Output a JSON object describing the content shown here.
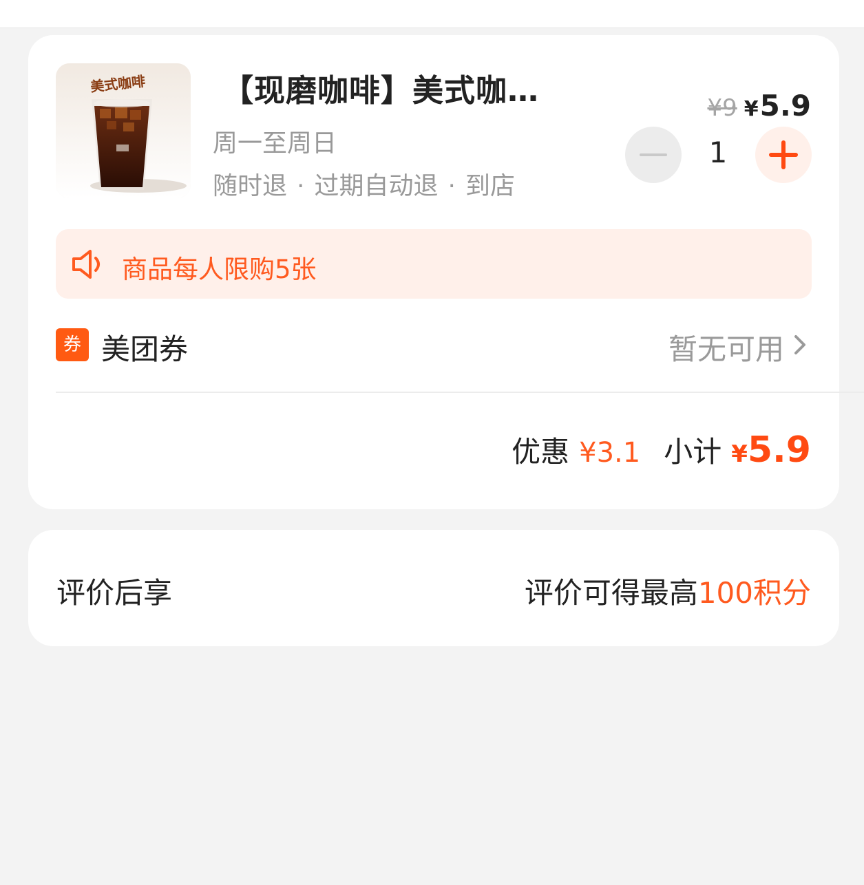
{
  "product": {
    "image_caption": "美式咖啡",
    "title": "【现磨咖啡】美式咖…",
    "validity": "周一至周日",
    "policy": [
      "随时退",
      "过期自动退",
      "到店"
    ],
    "policy_separator": "·",
    "original_price": "¥9",
    "currency_symbol": "¥",
    "price": "5.9",
    "quantity": "1"
  },
  "notice": {
    "icon": "speaker-icon",
    "text": "商品每人限购5张"
  },
  "coupon": {
    "badge": "券",
    "label": "美团券",
    "status": "暂无可用"
  },
  "totals": {
    "discount_label": "优惠",
    "discount_value": "¥3.1",
    "subtotal_label": "小计",
    "subtotal_symbol": "¥",
    "subtotal_value": "5.9"
  },
  "review": {
    "label": "评价后享",
    "note_prefix": "评价可得最高",
    "note_points": "100积分"
  },
  "colors": {
    "accent": "#ff5a1f",
    "notice_bg": "#fff0ea",
    "page_bg": "#f3f3f3"
  }
}
